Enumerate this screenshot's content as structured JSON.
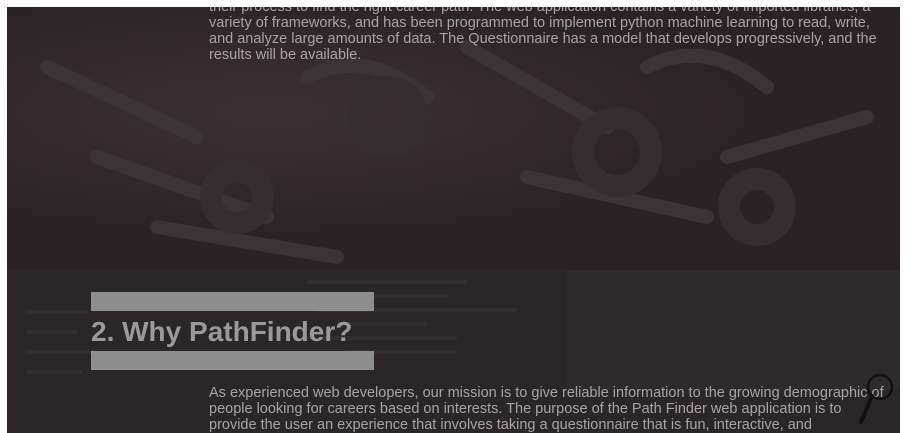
{
  "intro": {
    "text": "their process to find the right career path. The web application contains a variety of imported libraries, a variety of frameworks, and has been programmed to implement python machine learning to read, write, and analyze large amounts of data. The Questionnaire has a model that develops progressively, and the results will be available."
  },
  "section2": {
    "heading": "2. Why PathFinder?",
    "body": "As experienced web developers, our mission is to give reliable information to the growing demographic of people looking for careers based on interests. The purpose of the Path Finder web application is to provide the user an experience that involves taking a questionnaire that is fun, interactive, and"
  },
  "icons": {
    "search": "search-icon"
  },
  "colors": {
    "overlay": "#2a2326",
    "text": "#a9a3a5",
    "heading": "#9a9a9a",
    "bar": "#8e8e8e"
  }
}
